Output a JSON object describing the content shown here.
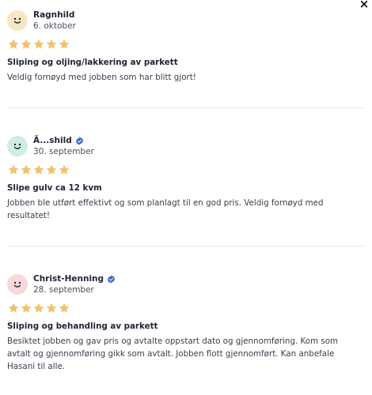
{
  "close_label": "×",
  "colors": {
    "star": "#f1c26a",
    "verified": "#3f63c9",
    "avatar_yellow": "#f7e7c6",
    "avatar_green": "#cdeee0",
    "avatar_pink": "#f8d8d8"
  },
  "reviews": [
    {
      "name": "Ragnhild",
      "verified": false,
      "date": "6. oktober",
      "rating": 5,
      "title": "Sliping og oljing/lakkering av parkett",
      "text": "Veldig fornøyd med jobben som har blitt gjort!",
      "avatar_color": "yellow"
    },
    {
      "name": "Ã...shild",
      "verified": true,
      "date": "30. september",
      "rating": 5,
      "title": "Slipe gulv ca 12 kvm",
      "text": "Jobben ble utført effektivt og som planlagt til en god pris. Veldig fornøyd med resultatet!",
      "avatar_color": "green"
    },
    {
      "name": "Christ-Henning",
      "verified": true,
      "date": "28. september",
      "rating": 5,
      "title": "Sliping og behandling av parkett",
      "text": "Besiktet jobben og gav pris og avtalte oppstart dato og gjennomføring. Kom som avtalt og gjennomføring gikk som avtalt. Jobben flott gjennomført. Kan anbefale Hasani til alle.",
      "avatar_color": "pink"
    }
  ]
}
